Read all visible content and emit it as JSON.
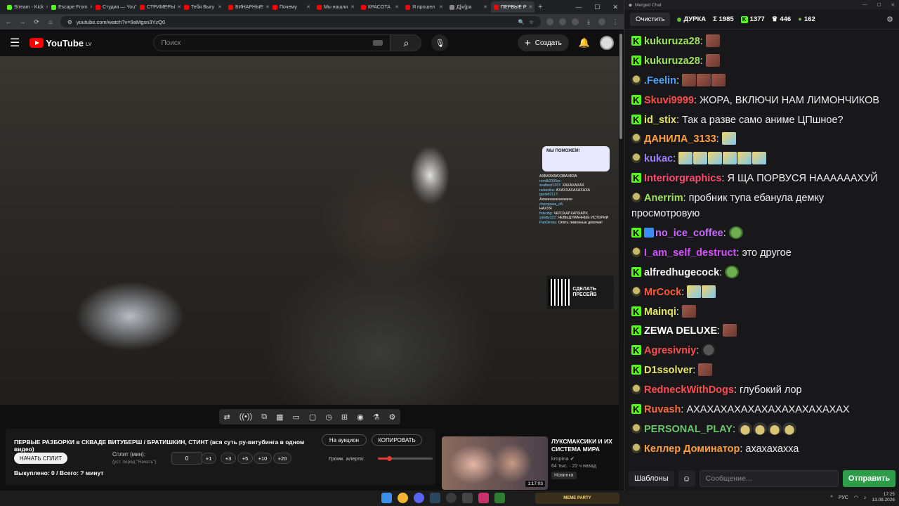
{
  "browser": {
    "tabs": [
      {
        "label": "Stream - Kick",
        "color": "#53fc18"
      },
      {
        "label": "Escape From",
        "color": "#53fc18"
      },
      {
        "label": "Студия — YouTube",
        "color": "#ff0000"
      },
      {
        "label": "СТРИМЕРЫ",
        "color": "#ff0000"
      },
      {
        "label": "Тебя Выгу",
        "color": "#ff0000"
      },
      {
        "label": "БИНАРНЫЕ",
        "color": "#ff0000"
      },
      {
        "label": "Почему",
        "color": "#ff0000"
      },
      {
        "label": "Мы нашли",
        "color": "#ff0000"
      },
      {
        "label": "КРАСОТА",
        "color": "#ff0000"
      },
      {
        "label": "Я прошел",
        "color": "#ff0000"
      },
      {
        "label": "Д[w]ра",
        "color": "#888888"
      },
      {
        "label": "ПЕРВЫЕ Р",
        "color": "#ff0000",
        "active": true
      }
    ],
    "url": "youtube.com/watch?v=9aMgsn3YzQ0",
    "window_controls": [
      "—",
      "☐",
      "✕"
    ]
  },
  "youtube": {
    "logo_text": "YouTube",
    "region": "LV",
    "search_placeholder": "Поиск",
    "create_label": "Создать"
  },
  "stream_overlay": {
    "donate_text": "МЫ ПОМОЖЕМ!",
    "chat_lines": [
      {
        "user": "",
        "text": "АХВАЗХВАХЗВАХВЗА"
      },
      {
        "user": "rcmilk2005rs:",
        "text": ""
      },
      {
        "user": "",
        "text": ""
      },
      {
        "user": "svalbert1337:",
        "text": "ХАХАХАХАХ"
      },
      {
        "user": "",
        "text": ""
      },
      {
        "user": "nekenika:",
        "text": "АХАХХАХАХАХАХА"
      },
      {
        "user": "garold2117:",
        "text": ""
      },
      {
        "user": "",
        "text": "Ахахахахахахахаха"
      },
      {
        "user": "cheropaxa_o5:",
        "text": ""
      },
      {
        "user": "",
        "text": "НАХУЯ"
      },
      {
        "user": "frdenbg:",
        "text": "ЧЕГОХАПХАПХАПХ"
      },
      {
        "user": "yakdly322:",
        "text": "НЕВЫДУМАННЫЕ ИСТОРИИ"
      },
      {
        "user": "PanDimka:",
        "text": "Опять лимонные девочки!"
      }
    ],
    "qr_label": "СДЕЛАТЬ ПРЕСЕЙВ"
  },
  "player_controls": [
    "⇄",
    "((•))",
    "⧉",
    "▦",
    "▭",
    "▢",
    "◷",
    "⊞",
    "◉",
    "⚗",
    "⚙"
  ],
  "extension_panel": {
    "title": "ПЕРВЫЕ РАЗБОРКИ в СКВАДЕ ВИТУБЕРШ / БРАТИШКИН, СТИНТ (вся суть ру-витубинга в одном видео)",
    "auction_label": "На аукцион",
    "copy_label": "КОПИРОВАТЬ",
    "start_split_label": "НАЧАТЬ СПЛИТ",
    "split_label": "Сплит (мин):",
    "split_hint": "(уст. перед \"Начать\")",
    "split_value": "0",
    "steps": [
      "+1",
      "+3",
      "+5",
      "+10",
      "+20"
    ],
    "alert_volume_label": "Громк. алерта:",
    "alert_volume": 0.2,
    "bought_text": "Выкуплено: 0 / Всего: ? минут"
  },
  "recommendation": {
    "title": "ЛУКСМАКСИКИ И ИХ СИСТЕМА МИРА",
    "channel": "kropina",
    "meta": "64 тыс. · 22 ч назад",
    "badge_new": "Новинка",
    "duration": "1:17:03"
  },
  "chat": {
    "window_title": "Merged Chat",
    "clear_label": "Очистить",
    "stream_name": "ДУРКА",
    "total_viewers": "Σ 1985",
    "kick_viewers": "1377",
    "other_viewers": "446",
    "third_viewers": "162",
    "messages": [
      {
        "platform": "kick",
        "user": "kukuruza28",
        "color": "#9ee35a",
        "text": "",
        "emotes": [
          "face"
        ]
      },
      {
        "platform": "kick",
        "user": "kukuruza28",
        "color": "#9ee35a",
        "text": "",
        "emotes": [
          "face"
        ]
      },
      {
        "platform": "other",
        "user": ".Feelin",
        "color": "#4aa3ff",
        "text": "",
        "emotes": [
          "face",
          "face",
          "face"
        ]
      },
      {
        "platform": "kick",
        "user": "Skuvi9999",
        "color": "#ff4d4d",
        "text": "ЖОРА, ВКЛЮЧИ НАМ ЛИМОНЧИКОВ",
        "emotes": []
      },
      {
        "platform": "kick",
        "user": "id_stix",
        "color": "#e6e66a",
        "text": "Так а разве само аниме ЦПшное?",
        "emotes": []
      },
      {
        "platform": "other",
        "user": "ДАНИЛА_3133",
        "color": "#ff9f40",
        "text": "",
        "emotes": [
          "cry"
        ]
      },
      {
        "platform": "other",
        "user": "kukac",
        "color": "#9d7cff",
        "text": "",
        "emotes": [
          "cry",
          "cry",
          "cry",
          "cry",
          "cry",
          "cry"
        ]
      },
      {
        "platform": "kick",
        "user": "Interiorgraphics",
        "color": "#ff4d6d",
        "text": "Я ЩА ПОРВУСЯ НААААААХУЙ",
        "emotes": []
      },
      {
        "platform": "other",
        "user": "Anerrim",
        "color": "#9ee35a",
        "text": "пробник тупа ебанула демку просмотровую",
        "emotes": []
      },
      {
        "platform": "kick",
        "user": "no_ice_coffee",
        "color": "#c86bff",
        "text": "",
        "emotes": [
          "pepe"
        ],
        "badge": true
      },
      {
        "platform": "other",
        "user": "I_am_self_destruct",
        "color": "#d44dff",
        "text": "это другое",
        "emotes": []
      },
      {
        "platform": "kick",
        "user": "alfredhugecock",
        "color": "#f4f4f4",
        "text": "",
        "emotes": [
          "pepe"
        ]
      },
      {
        "platform": "other",
        "user": "MrCock",
        "color": "#ff5a36",
        "text": "",
        "emotes": [
          "cry",
          "cry"
        ]
      },
      {
        "platform": "kick",
        "user": "Mainqi",
        "color": "#e6e66a",
        "text": "",
        "emotes": [
          "face"
        ]
      },
      {
        "platform": "kick",
        "user": "ZEWA DELUXE",
        "color": "#ffffff",
        "text": "",
        "emotes": [
          "face"
        ]
      },
      {
        "platform": "kick",
        "user": "Agresivniy",
        "color": "#ff4d4d",
        "text": "",
        "emotes": [
          "dark"
        ]
      },
      {
        "platform": "kick",
        "user": "D1ssolver",
        "color": "#e6e66a",
        "text": "",
        "emotes": [
          "face"
        ]
      },
      {
        "platform": "other",
        "user": "RedneckWithDogs",
        "color": "#ff4d4d",
        "text": "глубокий лор",
        "emotes": []
      },
      {
        "platform": "kick",
        "user": "Ruvash",
        "color": "#ff6a3d",
        "text": "АХАХАХАХАХАХАХАХАХАХАХАХ",
        "emotes": []
      },
      {
        "platform": "other",
        "user": "PERSONAL_PLAY",
        "color": "#6ac46a",
        "text": "",
        "emotes": [
          "hat",
          "hat",
          "hat",
          "hat"
        ]
      },
      {
        "platform": "other",
        "user": "Келлер Доминатор",
        "color": "#ff9f40",
        "text": "ахахахахха",
        "emotes": []
      }
    ],
    "templates_label": "Шаблоны",
    "input_placeholder": "Сообщение...",
    "send_label": "Отправить"
  },
  "taskbar": {
    "widget_label": "MEME PARTY",
    "lang": "РУС",
    "time": "17:25",
    "date": "13.08.2026"
  }
}
